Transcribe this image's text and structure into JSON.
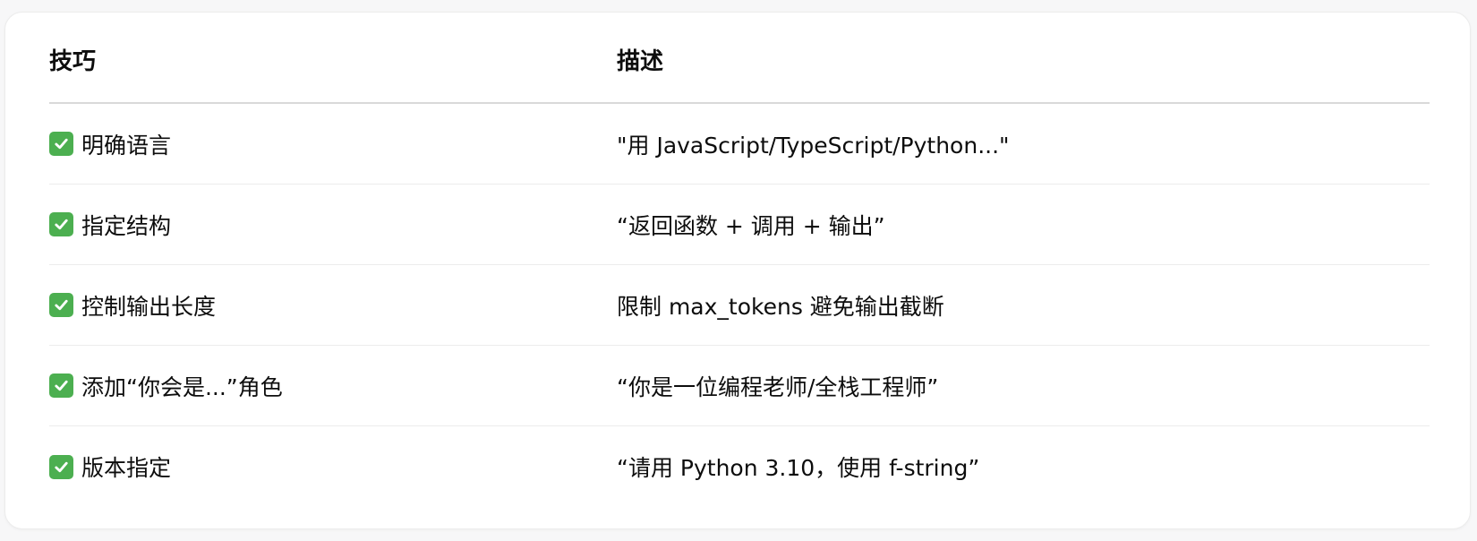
{
  "table": {
    "headers": {
      "technique": "技巧",
      "description": "描述"
    },
    "check_icon": "white-heavy-check-mark-icon",
    "check_color": "#4caf50",
    "rows": [
      {
        "technique": "明确语言",
        "description": "\"用 JavaScript/TypeScript/Python...\""
      },
      {
        "technique": "指定结构",
        "description": "“返回函数 + 调用 + 输出”"
      },
      {
        "technique": "控制输出长度",
        "description": "限制 max_tokens 避免输出截断"
      },
      {
        "technique": "添加“你会是...”角色",
        "description": "“你是一位编程老师/全栈工程师”"
      },
      {
        "technique": "版本指定",
        "description": "“请用 Python 3.10，使用 f-string”"
      }
    ]
  }
}
